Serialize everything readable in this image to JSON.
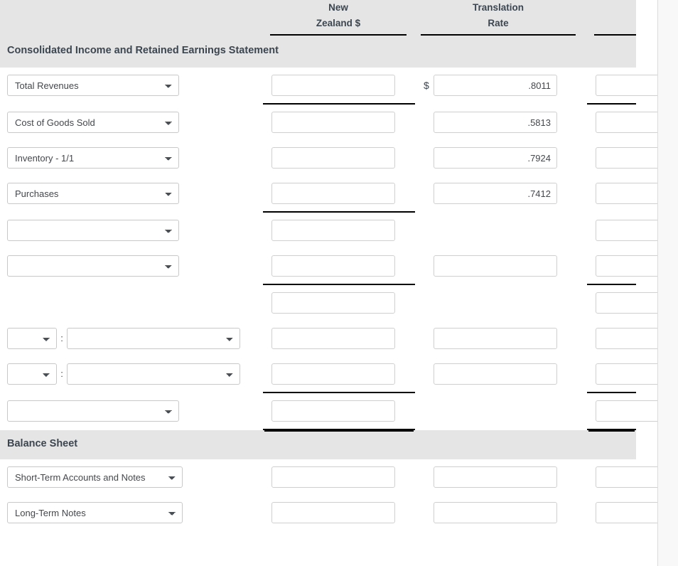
{
  "columns": {
    "nz": {
      "line1": "New",
      "line2": "Zealand $"
    },
    "rate": {
      "line1": "Translation",
      "line2": "Rate"
    },
    "us": {
      "line1": "",
      "line2": ""
    }
  },
  "sections": {
    "income": {
      "title": "Consolidated Income and Retained Earnings Statement"
    },
    "balance": {
      "title": "Balance Sheet"
    }
  },
  "currency_symbol": "$",
  "colon_separator": ":",
  "colors": {
    "band": "#e5e5e5",
    "heading_text": "#3c4650",
    "rule": "#000000",
    "input_border": "#cfcfcf",
    "select_border": "#c8c8c8",
    "gutter": "#f8f8f8"
  },
  "rows": [
    {
      "id": "total-revenues",
      "label": "Total Revenues",
      "nz_value": "",
      "rate_value": ".8011",
      "us_value": "",
      "show_dollar": true,
      "nz_rule": "single",
      "us_rule": "single"
    },
    {
      "id": "cost-of-goods-sold",
      "label": "Cost of Goods Sold",
      "nz_value": "",
      "rate_value": ".5813",
      "us_value": "",
      "show_dollar": false,
      "nz_rule": "none",
      "us_rule": "none"
    },
    {
      "id": "inventory-1-1",
      "label": "Inventory - 1/1",
      "nz_value": "",
      "rate_value": ".7924",
      "us_value": "",
      "show_dollar": false,
      "nz_rule": "none",
      "us_rule": "none"
    },
    {
      "id": "purchases",
      "label": "Purchases",
      "nz_value": "",
      "rate_value": ".7412",
      "us_value": "",
      "show_dollar": false,
      "nz_rule": "single",
      "us_rule": "none"
    },
    {
      "id": "blank-row-1",
      "label": "",
      "nz_value": "",
      "rate_value": null,
      "us_value": "",
      "show_dollar": false,
      "nz_rule": "none",
      "us_rule": "none"
    },
    {
      "id": "blank-row-2",
      "label": "",
      "nz_value": "",
      "rate_value": "",
      "us_value": "",
      "show_dollar": false,
      "nz_rule": "single",
      "us_rule": "single"
    },
    {
      "id": "blank-row-3",
      "label": null,
      "nz_value": "",
      "rate_value": null,
      "us_value": "",
      "show_dollar": false,
      "nz_rule": "none",
      "us_rule": "none"
    },
    {
      "id": "pair-row-1",
      "label_small": "",
      "label_long": "",
      "nz_value": "",
      "rate_value": "",
      "us_value": "",
      "show_dollar": false,
      "nz_rule": "none",
      "us_rule": "none",
      "paired": true
    },
    {
      "id": "pair-row-2",
      "label_small": "",
      "label_long": "",
      "nz_value": "",
      "rate_value": "",
      "us_value": "",
      "show_dollar": false,
      "nz_rule": "single",
      "us_rule": "single",
      "paired": true
    },
    {
      "id": "net-income-row",
      "label": "",
      "nz_value": "",
      "rate_value": null,
      "us_value": "",
      "show_dollar": false,
      "nz_rule": "double",
      "us_rule": "double"
    }
  ],
  "balance_rows": [
    {
      "id": "short-term-accounts-and-notes",
      "label": "Short-Term Accounts and Notes",
      "nz_value": "",
      "rate_value": "",
      "us_value": "",
      "nz_rule": "none",
      "us_rule": "none"
    },
    {
      "id": "long-term-notes",
      "label": "Long-Term Notes",
      "nz_value": "",
      "rate_value": "",
      "us_value": "",
      "nz_rule": "none",
      "us_rule": "none"
    }
  ]
}
